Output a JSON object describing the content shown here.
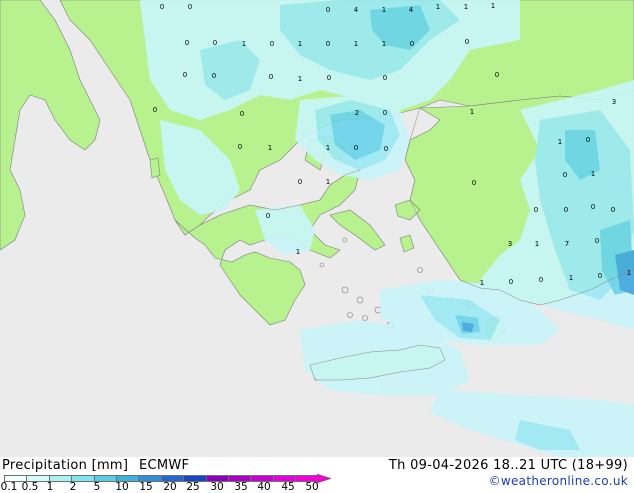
{
  "footer": {
    "title": "Precipitation [mm]",
    "model": "ECMWF",
    "valid_time": "Th 09-04-2026 18..21 UTC (18+99)",
    "credit": "©weatheronline.co.uk"
  },
  "legend": {
    "labels": [
      "0.1",
      "0.5",
      "1",
      "2",
      "5",
      "10",
      "15",
      "20",
      "25",
      "30",
      "35",
      "40",
      "45",
      "50"
    ],
    "colors": [
      "#f2fefe",
      "#d6fbfb",
      "#a8f1f5",
      "#7ee4f0",
      "#57cde8",
      "#3db2e0",
      "#2f8fd8",
      "#2168cf",
      "#1646c3",
      "#8b00b8",
      "#aa00c5",
      "#cb00d6",
      "#e500dd",
      "#f500d8"
    ]
  },
  "map": {
    "colors": {
      "sea": "#ebebeb",
      "land": "#b8f28f",
      "precip_light": "#c9f6fa",
      "precip_mid": "#9ce9f4",
      "precip_heavy": "#68d3ec",
      "precip_strong": "#3fa6e0"
    },
    "values": [
      "0",
      "0",
      "0",
      "4",
      "1",
      "4",
      "1",
      "1",
      "1",
      "0",
      "0",
      "1",
      "0",
      "1",
      "0",
      "1",
      "1",
      "0",
      "0",
      "0",
      "0",
      "0",
      "1",
      "0",
      "0",
      "0",
      "0",
      "2",
      "0",
      "0",
      "1",
      "3",
      "0",
      "1",
      "1",
      "0",
      "0",
      "1",
      "0",
      "0",
      "1",
      "0",
      "1",
      "0",
      "0",
      "0",
      "0",
      "0",
      "0",
      "1",
      "3",
      "1",
      "7",
      "0",
      "1",
      "0",
      "0",
      "1",
      "0",
      "1",
      "0",
      "0",
      "0",
      "0",
      "0",
      "1"
    ]
  }
}
